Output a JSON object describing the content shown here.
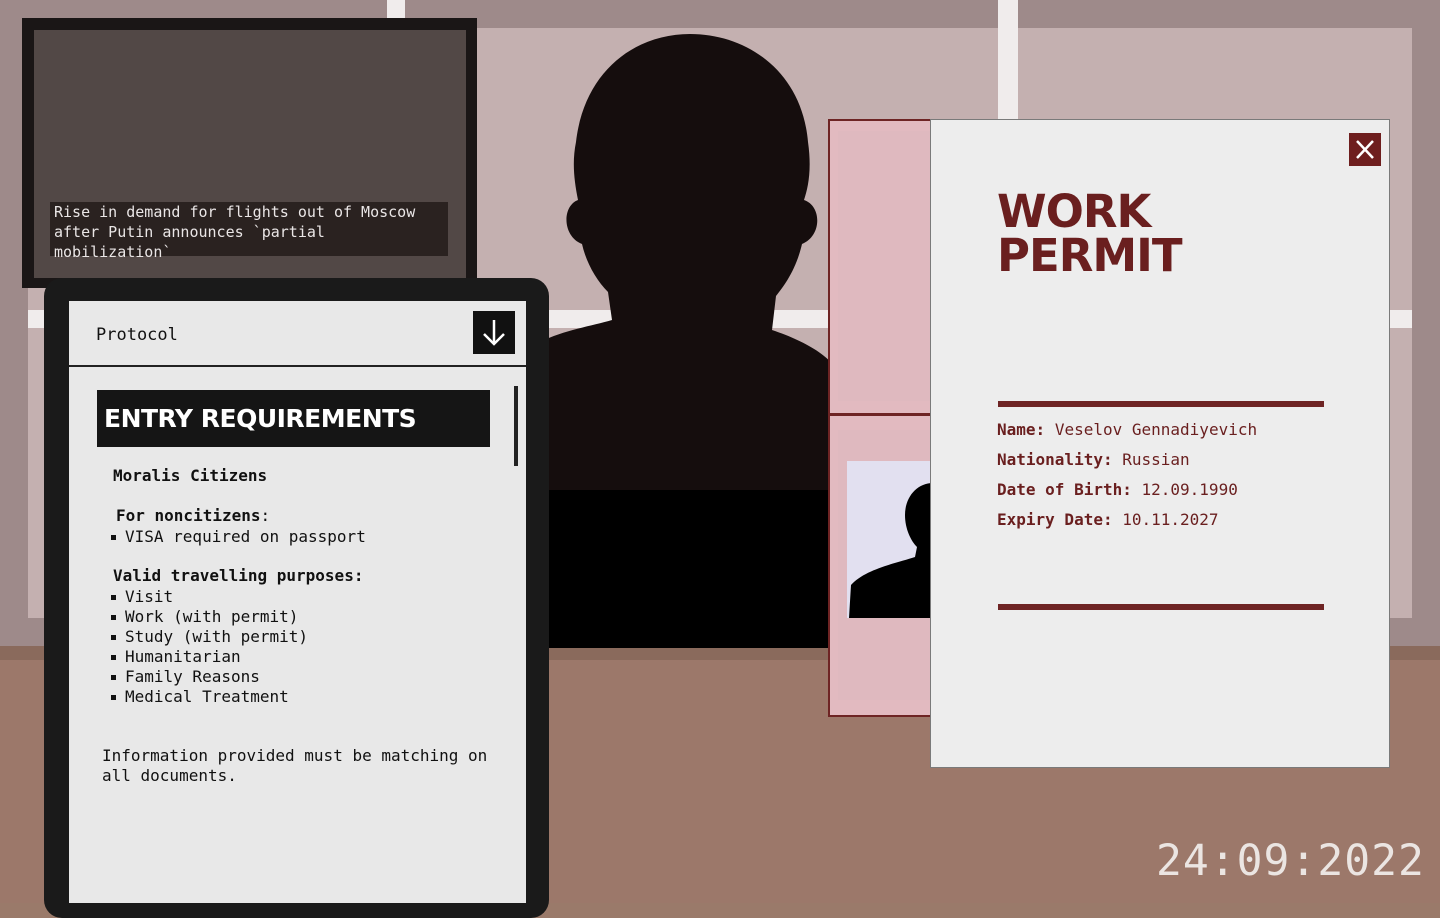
{
  "tv": {
    "caption_line1": "Rise in demand for flights out of Moscow",
    "caption_line2": "after Putin announces `partial mobilization`"
  },
  "protocol": {
    "label": "Protocol",
    "toggle_icon": "arrow-down-icon",
    "banner": "ENTRY REQUIREMENTS",
    "section1_title": "Moralis Citizens",
    "section2_title": "For noncitizens",
    "section2_suffix": ":",
    "section2_items": [
      "VISA required on passport"
    ],
    "section3_title": "Valid travelling purposes:",
    "section3_items": [
      "Visit",
      "Work (with permit)",
      "Study (with permit)",
      "Humanitarian",
      "Family Reasons",
      "Medical Treatment"
    ],
    "note_line1": "Information provided must be matching on",
    "note_line2": "all documents."
  },
  "permit": {
    "title_line1": "WORK",
    "title_line2": "PERMIT",
    "close_icon": "close-icon",
    "name_label": "Name:",
    "name_value": "Veselov Gennadiyevich",
    "nationality_label": "Nationality:",
    "nationality_value": "Russian",
    "dob_label": "Date of Birth:",
    "dob_value": "12.09.1990",
    "expiry_label": "Expiry Date:",
    "expiry_value": "10.11.2027",
    "accent_color": "#6e2424"
  },
  "game_date": "24:09:2022"
}
